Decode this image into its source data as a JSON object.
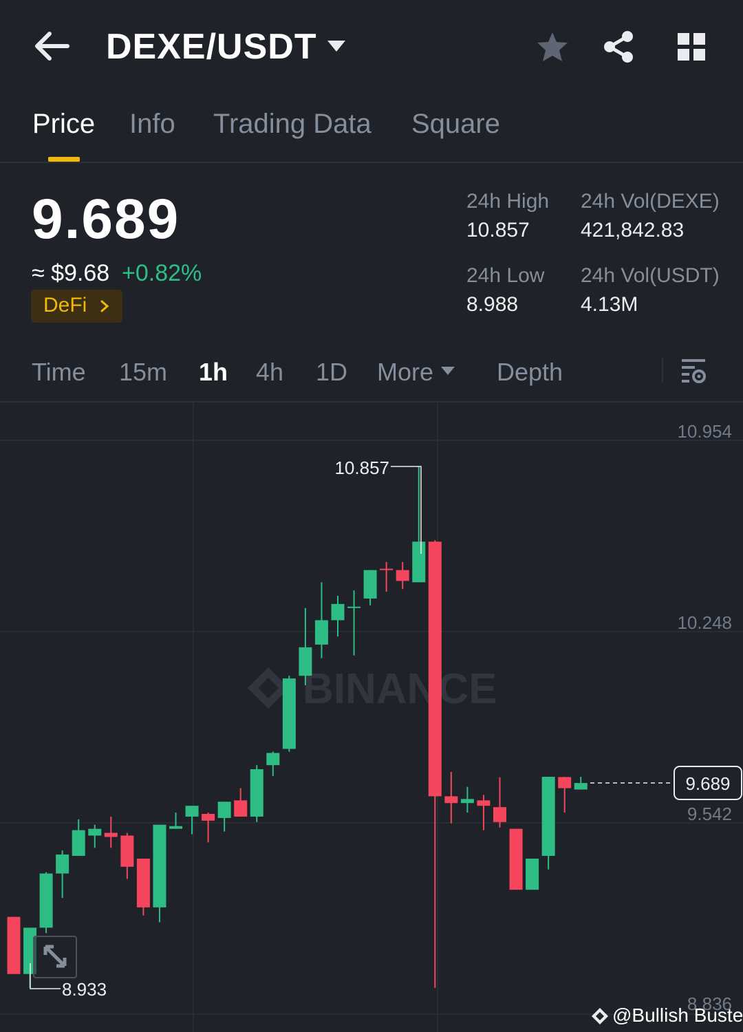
{
  "header": {
    "pair": "DEXE/USDT",
    "icons": [
      "back-arrow-icon",
      "caret-down-icon",
      "star-icon",
      "share-icon",
      "grid-icon"
    ]
  },
  "tabs": [
    {
      "label": "Price",
      "active": true
    },
    {
      "label": "Info",
      "active": false
    },
    {
      "label": "Trading Data",
      "active": false
    },
    {
      "label": "Square",
      "active": false
    }
  ],
  "ticker": {
    "last_price": "9.689",
    "fiat_price": "≈ $9.68",
    "change_pct": "+0.82%",
    "tag": "DeFi",
    "high_label": "24h High",
    "high_value": "10.857",
    "low_label": "24h Low",
    "low_value": "8.988",
    "vol_base_label": "24h Vol(DEXE)",
    "vol_base_value": "421,842.83",
    "vol_quote_label": "24h Vol(USDT)",
    "vol_quote_value": "4.13M"
  },
  "intervals": [
    {
      "label": "Time",
      "active": false
    },
    {
      "label": "15m",
      "active": false
    },
    {
      "label": "1h",
      "active": true
    },
    {
      "label": "4h",
      "active": false
    },
    {
      "label": "1D",
      "active": false
    },
    {
      "label": "More",
      "active": false
    },
    {
      "label": "Depth",
      "active": false
    }
  ],
  "colors": {
    "background": "#1f2329",
    "up": "#2ebd85",
    "down": "#f6465d",
    "accent": "#f0b90b",
    "muted": "#848e9c"
  },
  "chart_data": {
    "type": "candlestick",
    "interval": "1h",
    "y_ticks": [
      "10.954",
      "10.248",
      "9.542",
      "8.836"
    ],
    "ylim": [
      8.836,
      10.954
    ],
    "current_price_label": "9.689",
    "high_marker": "10.857",
    "low_marker": "8.933",
    "watermark": "BINANCE",
    "candles": [
      {
        "o": 9.195,
        "h": 9.195,
        "l": 8.984,
        "c": 8.984
      },
      {
        "o": 8.984,
        "h": 9.07,
        "l": 8.933,
        "c": 9.155
      },
      {
        "o": 9.155,
        "h": 9.36,
        "l": 9.135,
        "c": 9.355
      },
      {
        "o": 9.355,
        "h": 9.44,
        "l": 9.265,
        "c": 9.425
      },
      {
        "o": 9.42,
        "h": 9.555,
        "l": 9.42,
        "c": 9.515
      },
      {
        "o": 9.495,
        "h": 9.535,
        "l": 9.45,
        "c": 9.52
      },
      {
        "o": 9.505,
        "h": 9.565,
        "l": 9.45,
        "c": 9.49
      },
      {
        "o": 9.495,
        "h": 9.505,
        "l": 9.335,
        "c": 9.38
      },
      {
        "o": 9.41,
        "h": 9.41,
        "l": 9.2,
        "c": 9.23
      },
      {
        "o": 9.23,
        "h": 9.53,
        "l": 9.175,
        "c": 9.535
      },
      {
        "o": 9.52,
        "h": 9.58,
        "l": 9.52,
        "c": 9.53
      },
      {
        "o": 9.565,
        "h": 9.605,
        "l": 9.5,
        "c": 9.605
      },
      {
        "o": 9.575,
        "h": 9.58,
        "l": 9.47,
        "c": 9.55
      },
      {
        "o": 9.56,
        "h": 9.585,
        "l": 9.51,
        "c": 9.62
      },
      {
        "o": 9.625,
        "h": 9.67,
        "l": 9.565,
        "c": 9.565
      },
      {
        "o": 9.565,
        "h": 9.755,
        "l": 9.545,
        "c": 9.74
      },
      {
        "o": 9.755,
        "h": 9.805,
        "l": 9.715,
        "c": 9.8
      },
      {
        "o": 9.815,
        "h": 10.085,
        "l": 9.805,
        "c": 10.075
      },
      {
        "o": 10.085,
        "h": 10.335,
        "l": 10.05,
        "c": 10.19
      },
      {
        "o": 10.2,
        "h": 10.43,
        "l": 10.15,
        "c": 10.29
      },
      {
        "o": 10.29,
        "h": 10.38,
        "l": 10.23,
        "c": 10.35
      },
      {
        "o": 10.335,
        "h": 10.4,
        "l": 10.16,
        "c": 10.34
      },
      {
        "o": 10.37,
        "h": 10.455,
        "l": 10.345,
        "c": 10.475
      },
      {
        "o": 10.48,
        "h": 10.505,
        "l": 10.395,
        "c": 10.475
      },
      {
        "o": 10.475,
        "h": 10.505,
        "l": 10.405,
        "c": 10.435
      },
      {
        "o": 10.43,
        "h": 10.857,
        "l": 10.43,
        "c": 10.58
      },
      {
        "o": 10.58,
        "h": 10.585,
        "l": 8.933,
        "c": 9.64
      }
    ],
    "candles_tail": [
      {
        "o": 9.64,
        "h": 9.73,
        "l": 9.54,
        "c": 9.615
      },
      {
        "o": 9.615,
        "h": 9.675,
        "l": 9.58,
        "c": 9.63
      },
      {
        "o": 9.625,
        "h": 9.645,
        "l": 9.515,
        "c": 9.605
      },
      {
        "o": 9.6,
        "h": 9.71,
        "l": 9.525,
        "c": 9.545
      },
      {
        "o": 9.52,
        "h": 9.52,
        "l": 9.295,
        "c": 9.295
      },
      {
        "o": 9.295,
        "h": 9.385,
        "l": 9.295,
        "c": 9.41
      },
      {
        "o": 9.42,
        "h": 9.712,
        "l": 9.37,
        "c": 9.712
      },
      {
        "o": 9.711,
        "h": 9.712,
        "l": 9.58,
        "c": 9.67
      },
      {
        "o": 9.665,
        "h": 9.712,
        "l": 9.665,
        "c": 9.689
      }
    ]
  },
  "watermark_credit": "@Bullish Buster"
}
